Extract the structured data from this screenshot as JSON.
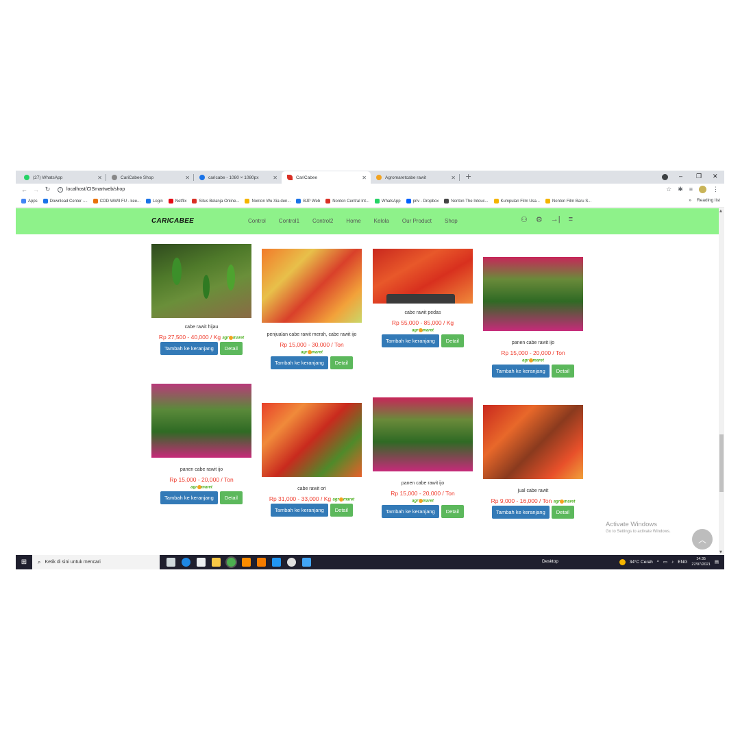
{
  "browser": {
    "tabs": [
      {
        "title": "(27) WhatsApp",
        "icon_color": "#25d366"
      },
      {
        "title": "CariCabee Shop",
        "icon_color": "#888888"
      },
      {
        "title": "caricabe - 1080 × 1080px",
        "icon_color": "#1a73e8"
      },
      {
        "title": "CariCabee",
        "icon_color": "#d93025"
      },
      {
        "title": "Agromaretcabe rawit",
        "icon_color": "#f2a31f"
      }
    ],
    "new_tab": "+",
    "window_controls": {
      "minimize": "–",
      "restore": "❐",
      "close": "✕"
    },
    "url": "localhost/CISmartweb/shop",
    "bookmarks": [
      {
        "label": "Apps",
        "icon_color": "#4285f4"
      },
      {
        "label": "Download Center -...",
        "icon_color": "#1a73e8"
      },
      {
        "label": "COD WWII FU - kee...",
        "icon_color": "#e8710a"
      },
      {
        "label": "Login",
        "icon_color": "#1a73e8"
      },
      {
        "label": "Netflix",
        "icon_color": "#e50914"
      },
      {
        "label": "Situs Belanja Online...",
        "icon_color": "#d93025"
      },
      {
        "label": "Nonton Wu Xia den...",
        "icon_color": "#f4b400"
      },
      {
        "label": "BJP Web",
        "icon_color": "#1a73e8"
      },
      {
        "label": "Nonton Central Int...",
        "icon_color": "#d93025"
      },
      {
        "label": "WhatsApp",
        "icon_color": "#25d366"
      },
      {
        "label": "priv - Dropbox",
        "icon_color": "#0061ff"
      },
      {
        "label": "Nonton The Intouc...",
        "icon_color": "#444444"
      },
      {
        "label": "Kumpulan Film Usa...",
        "icon_color": "#f4b400"
      },
      {
        "label": "Nonton Film Baru S...",
        "icon_color": "#f4b400"
      }
    ],
    "more_bookmarks": "»",
    "reading_list": "Reading list"
  },
  "site": {
    "brand": "CARICABEE",
    "menu": [
      "Control",
      "Control1",
      "Control2",
      "Home",
      "Kelola",
      "Our Product",
      "Shop"
    ],
    "nav_bg": "#8ef28a"
  },
  "products": [
    {
      "name": "cabe rawit hijau",
      "price": "Rp 27,500 - 40,000 / Kg"
    },
    {
      "name": "penjualan cabe rawit merah, cabe rawit ijo",
      "price": "Rp 15,000 - 30,000 / Ton"
    },
    {
      "name": "cabe rawit pedas",
      "price": "Rp 55,000 - 85,000 / Kg"
    },
    {
      "name": "panen cabe rawit ijo",
      "price": "Rp 15,000 - 20,000 / Ton"
    },
    {
      "name": "panen cabe rawit ijo",
      "price": "Rp 15,000 - 20,000 / Ton"
    },
    {
      "name": "cabe rawit ori",
      "price": "Rp 31,000 - 33,000 / Kg"
    },
    {
      "name": "panen cabe rawit ijo",
      "price": "Rp 15,000 - 20,000 / Ton"
    },
    {
      "name": "jual cabe rawit",
      "price": "Rp 9,000 - 16,000 / Ton"
    }
  ],
  "buttons": {
    "add_to_cart": "Tambah ke keranjang",
    "detail": "Detail"
  },
  "agro_logo": {
    "pre": "agr",
    "post": "maret"
  },
  "watermark": {
    "line1": "Activate Windows",
    "line2": "Go to Settings to activate Windows."
  },
  "taskbar": {
    "search_placeholder": "Ketik di sini untuk mencari",
    "desktop_label": "Desktop",
    "weather": "34°C  Cerah",
    "language": "ENG",
    "time": "14:35",
    "date": "27/07/2021"
  }
}
